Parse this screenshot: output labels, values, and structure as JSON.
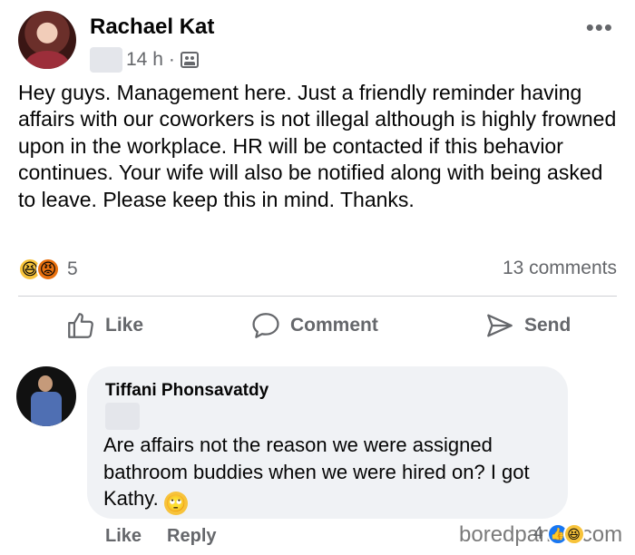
{
  "post": {
    "author": "Rachael Kat",
    "time": "14 h",
    "separator": "·",
    "audience_icon": "group-audience-icon",
    "more_icon": "•••",
    "text": "Hey guys. Management here. Just a friendly reminder having affairs with our coworkers is not illegal although is highly frowned upon in the workplace. HR will be contacted if this behavior continues. Your wife will also be notified along with being asked to leave. Please keep this in mind. Thanks.",
    "reaction_emojis": [
      "😆",
      "😡"
    ],
    "reaction_count": "5",
    "comments_count": "13 comments"
  },
  "actions": {
    "like": "Like",
    "comment": "Comment",
    "send": "Send"
  },
  "comment": {
    "author": "Tiffani Phonsavatdy",
    "text": "Are affairs not the reason we were assigned bathroom buddies when we were hired on? I got Kathy.",
    "emoji": "🙄",
    "like_label": "Like",
    "reply_label": "Reply",
    "reaction_count": "4",
    "reaction_emojis": [
      "👍",
      "😆"
    ]
  },
  "watermark": "boredpanda.com"
}
